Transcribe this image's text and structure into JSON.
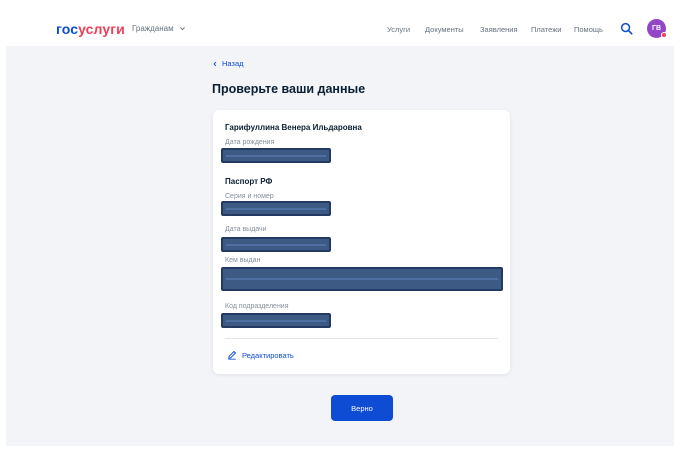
{
  "header": {
    "logo_part1": "гос",
    "logo_part2": "услуги",
    "role": "Гражданам",
    "nav": [
      "Услуги",
      "Документы",
      "Заявления",
      "Платежи",
      "Помощь"
    ],
    "avatar_initials": "ГВ"
  },
  "main": {
    "back_label": "Назад",
    "title": "Проверьте ваши данные"
  },
  "card": {
    "full_name": "Гарифуллина Венера Ильдаровна",
    "birth_label": "Дата рождения",
    "passport_title": "Паспорт РФ",
    "series_label": "Серия и номер",
    "issue_date_label": "Дата выдачи",
    "issued_by_label": "Кем выдан",
    "division_code_label": "Код подразделения",
    "edit_label": "Редактировать"
  },
  "confirm_label": "Верно",
  "colors": {
    "brand_blue": "#0d4cd3",
    "brand_red": "#ee3f58",
    "avatar": "#9147c6",
    "background": "#f2f4f7"
  }
}
